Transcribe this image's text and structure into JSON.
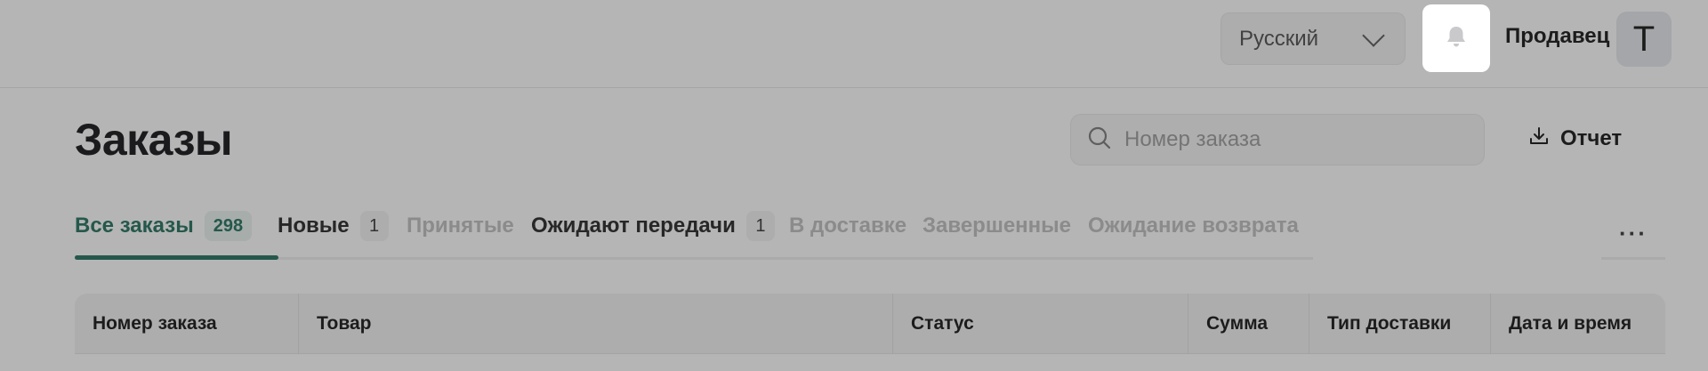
{
  "header": {
    "language": {
      "selected": "Русский",
      "chevron_icon": "chevron-down-icon"
    },
    "notifications": {
      "icon": "bell-icon"
    },
    "user": {
      "name": "Продавец",
      "avatar_letter": "T"
    }
  },
  "page": {
    "title": "Заказы",
    "search": {
      "placeholder": "Номер заказа",
      "icon": "search-icon"
    },
    "report": {
      "label": "Отчет",
      "icon": "download-icon"
    }
  },
  "tabs": [
    {
      "label": "Все заказы",
      "count": "298",
      "state": "active"
    },
    {
      "label": "Новые",
      "count": "1",
      "state": "normal"
    },
    {
      "label": "Принятые",
      "count": null,
      "state": "disabled"
    },
    {
      "label": "Ожидают передачи",
      "count": "1",
      "state": "normal"
    },
    {
      "label": "В доставке",
      "count": null,
      "state": "disabled"
    },
    {
      "label": "Завершенные",
      "count": null,
      "state": "disabled"
    },
    {
      "label": "Ожидание возврата",
      "count": null,
      "state": "disabled"
    }
  ],
  "more": {
    "label": "···",
    "icon": "more-horizontal-icon"
  },
  "table": {
    "columns": [
      "Номер заказа",
      "Товар",
      "Статус",
      "Сумма",
      "Тип доставки",
      "Дата и время"
    ]
  },
  "colors": {
    "accent": "#1f6e5a",
    "overlay": "rgba(50,50,50,0.36)"
  }
}
